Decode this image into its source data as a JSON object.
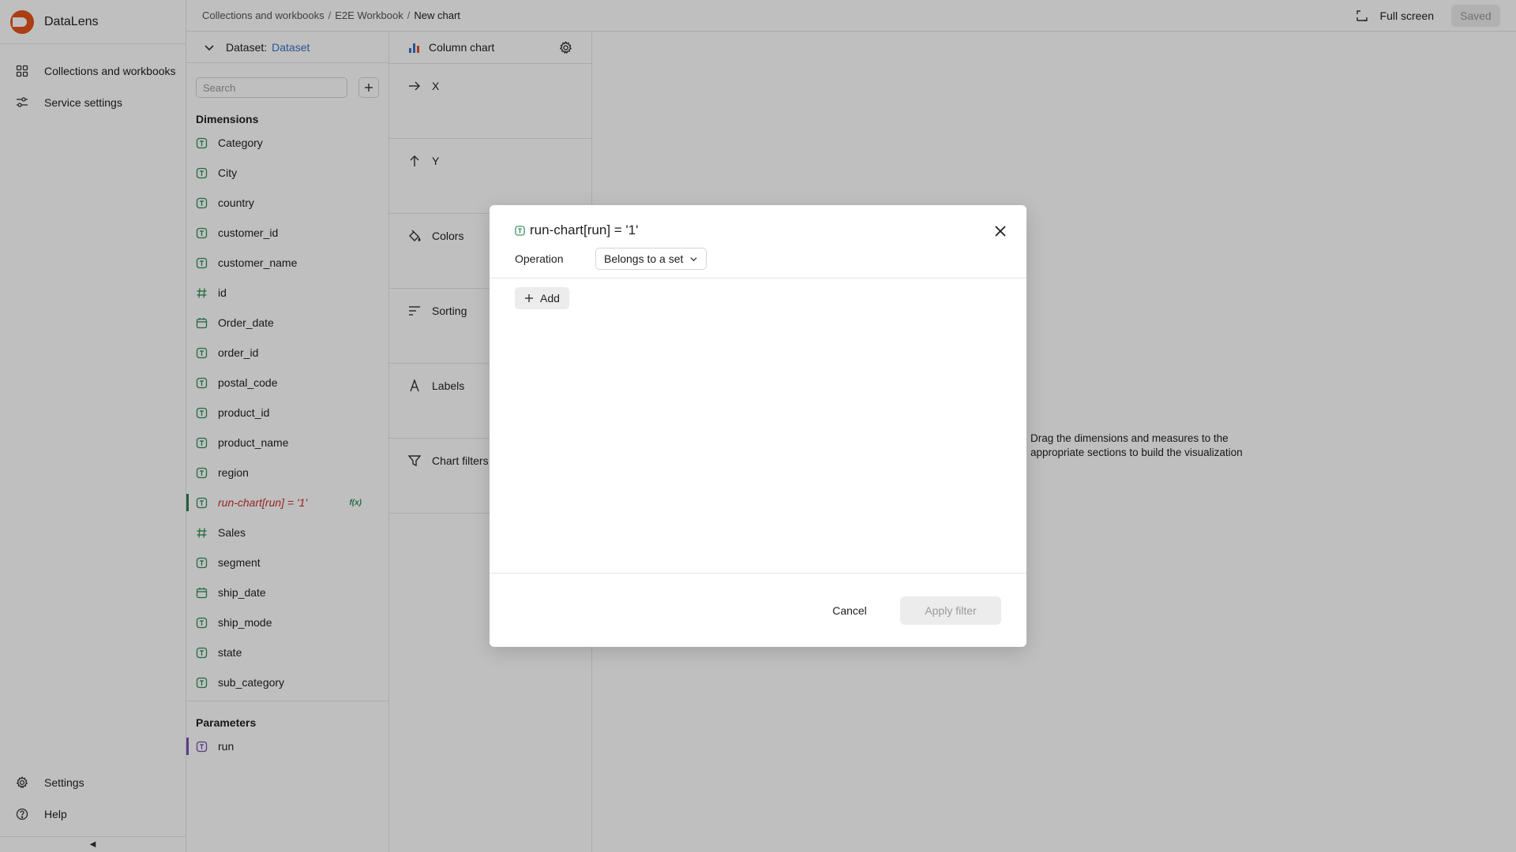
{
  "app": {
    "name": "DataLens",
    "brand_color": "#e5531a"
  },
  "nav": {
    "top": [
      {
        "label": "Collections and workbooks",
        "icon": "grid-icon"
      },
      {
        "label": "Service settings",
        "icon": "sliders-icon"
      }
    ],
    "bottom": [
      {
        "label": "Settings",
        "icon": "gear-icon"
      },
      {
        "label": "Help",
        "icon": "help-icon"
      }
    ],
    "collapse_glyph": "◀"
  },
  "header": {
    "breadcrumbs": [
      "Collections and workbooks",
      "E2E Workbook"
    ],
    "separator": "/",
    "current": "New chart",
    "fullscreen_label": "Full screen",
    "saved_label": "Saved"
  },
  "dataset": {
    "label": "Dataset:",
    "name": "Dataset",
    "search_placeholder": "Search",
    "dimensions_title": "Dimensions",
    "dimensions": [
      {
        "name": "Category",
        "type": "string"
      },
      {
        "name": "City",
        "type": "string"
      },
      {
        "name": "country",
        "type": "string"
      },
      {
        "name": "customer_id",
        "type": "string"
      },
      {
        "name": "customer_name",
        "type": "string"
      },
      {
        "name": "id",
        "type": "number"
      },
      {
        "name": "Order_date",
        "type": "date"
      },
      {
        "name": "order_id",
        "type": "string"
      },
      {
        "name": "postal_code",
        "type": "string"
      },
      {
        "name": "product_id",
        "type": "string"
      },
      {
        "name": "product_name",
        "type": "string"
      },
      {
        "name": "region",
        "type": "string"
      },
      {
        "name": "run-chart[run] = '1'",
        "type": "string",
        "active": true,
        "badge": "f(x)"
      },
      {
        "name": "Sales",
        "type": "number"
      },
      {
        "name": "segment",
        "type": "string"
      },
      {
        "name": "ship_date",
        "type": "date"
      },
      {
        "name": "ship_mode",
        "type": "string"
      },
      {
        "name": "state",
        "type": "string"
      },
      {
        "name": "sub_category",
        "type": "string"
      }
    ],
    "parameters_title": "Parameters",
    "parameters": [
      {
        "name": "run",
        "type": "string"
      }
    ]
  },
  "visualization": {
    "chart_type": "Column chart",
    "sections": [
      {
        "label": "X",
        "icon": "arrow-right-icon"
      },
      {
        "label": "Y",
        "icon": "arrow-up-icon"
      },
      {
        "label": "Colors",
        "icon": "paint-bucket-icon"
      },
      {
        "label": "Sorting",
        "icon": "sort-icon"
      },
      {
        "label": "Labels",
        "icon": "label-a-icon"
      },
      {
        "label": "Chart filters",
        "icon": "funnel-icon"
      }
    ]
  },
  "workspace": {
    "empty_message": "Drag the dimensions and measures to the appropriate sections to build the visualization"
  },
  "dialog": {
    "title": "run-chart[run] = '1'",
    "operation_label": "Operation",
    "operation_value": "Belongs to a set",
    "add_label": "Add",
    "cancel_label": "Cancel",
    "apply_label": "Apply filter"
  },
  "colors": {
    "string_icon": "#2f8c57",
    "parameter_icon": "#7a4fb5",
    "active_field_text": "#c7312e",
    "chart_icon": "#3a6fc4"
  }
}
